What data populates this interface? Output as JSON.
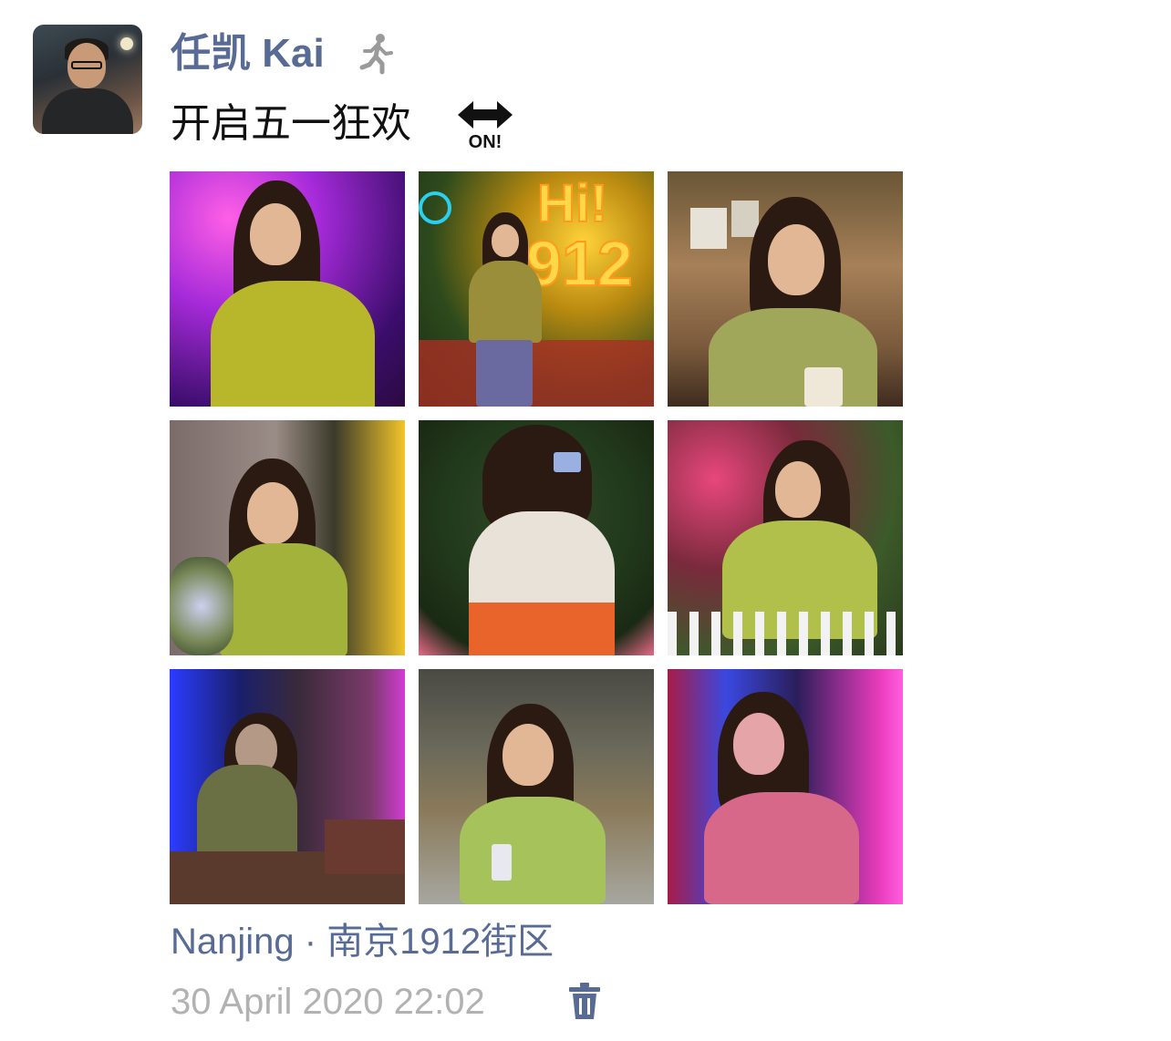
{
  "post": {
    "username": "任凯 Kai",
    "status_icon": "walking-person-icon",
    "text": "开启五一狂欢",
    "emoji": "on-arrow-icon",
    "emoji_text": "ON!",
    "photos": [
      {
        "label": "photo-neon-purple-trees"
      },
      {
        "label": "photo-hi-1912-sign",
        "sign_text": "Hi! 1912"
      },
      {
        "label": "photo-cafe-eating"
      },
      {
        "label": "photo-brick-wall-flowers"
      },
      {
        "label": "photo-back-taking-picture"
      },
      {
        "label": "photo-rose-wall-fence"
      },
      {
        "label": "photo-blue-neon-sitting"
      },
      {
        "label": "photo-street-phone"
      },
      {
        "label": "photo-pink-neon-phone"
      }
    ],
    "location": "Nanjing · 南京1912街区",
    "timestamp": "30 April 2020 22:02",
    "delete_icon": "trash-icon"
  },
  "colors": {
    "link": "#576b95",
    "text": "#111111",
    "meta": "#b2b2b2"
  }
}
